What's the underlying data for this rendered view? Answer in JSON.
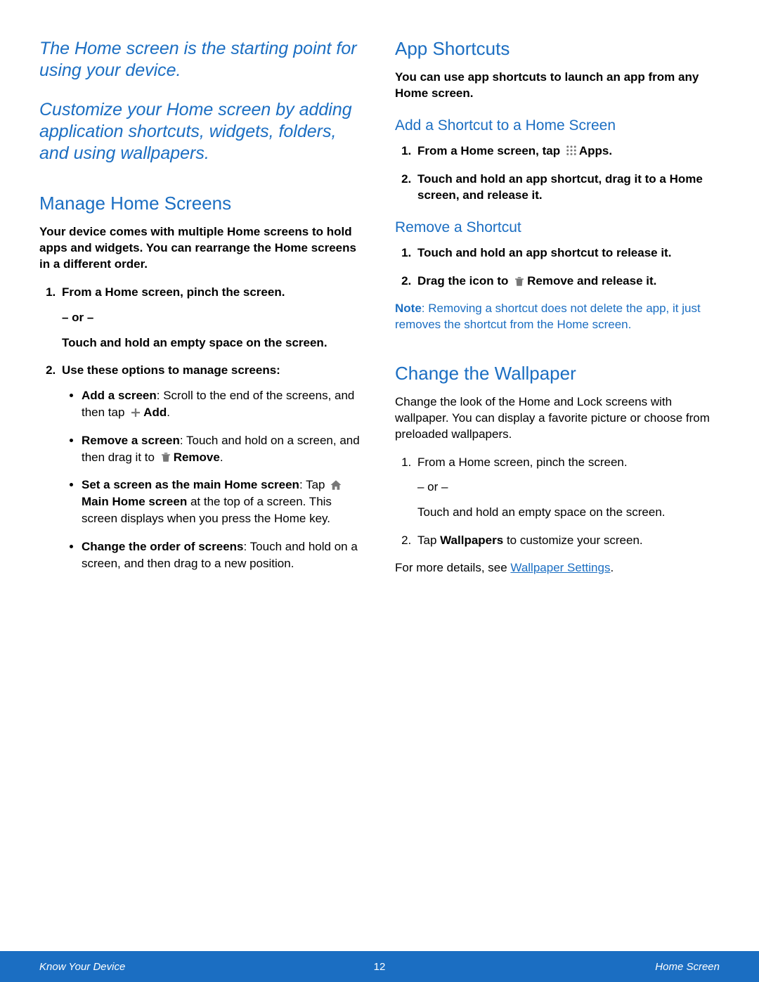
{
  "intro": {
    "p1": "The Home screen is the starting point for using your device.",
    "p2": "Customize your Home screen by adding application shortcuts, widgets, folders, and using wallpapers."
  },
  "manage": {
    "title": "Manage Home Screens",
    "desc": "Your device comes with multiple Home screens to hold apps and widgets. You can rearrange the Home screens in a different order.",
    "s1a": "From a Home screen, pinch the screen.",
    "or": "– or –",
    "s1b": "Touch and hold an empty space on the screen.",
    "s2": "Use these options to manage screens:",
    "b1a": "Add a screen",
    "b1b": ": Scroll to the end of the screens, and then tap ",
    "b1c": "Add",
    "b1d": ".",
    "b2a": "Remove a screen",
    "b2b": ": Touch and hold on a screen, and then drag it to ",
    "b2c": "Remove",
    "b2d": ".",
    "b3a": "Set a screen as the main Home screen",
    "b3b": ": Tap ",
    "b3c": "Main Home screen",
    "b3d": " at the top of a screen. This screen displays when you press the Home key.",
    "b4a": "Change the order of screens",
    "b4b": ": Touch and hold on a screen, and then drag to a new position."
  },
  "shortcuts": {
    "title": "App Shortcuts",
    "desc": "You can use app shortcuts to launch an app from any Home screen.",
    "add_title": "Add a Shortcut to a Home Screen",
    "a1a": "From a Home screen, tap ",
    "a1b": "Apps",
    "a1c": ".",
    "a2": "Touch and hold an app shortcut, drag it to a Home screen, and release it.",
    "rem_title": "Remove a Shortcut",
    "r1": "Touch and hold an app shortcut to release it.",
    "r2a": "Drag the icon to ",
    "r2b": "Remove",
    "r2c": " and release it.",
    "note_label": "Note",
    "note_body": ": Removing a shortcut does not delete the app, it just removes the shortcut from the Home screen."
  },
  "wallpaper": {
    "title": "Change the Wallpaper",
    "desc": "Change the look of the Home and Lock screens with wallpaper. You can display a favorite picture or choose from preloaded wallpapers.",
    "s1a": "From a Home screen, pinch the screen.",
    "or": "– or –",
    "s1b": "Touch and hold an empty space on the screen.",
    "s2a": "Tap ",
    "s2b": "Wallpapers",
    "s2c": " to customize your screen.",
    "more_a": "For more details, see ",
    "more_link": "Wallpaper Settings",
    "more_b": "."
  },
  "footer": {
    "left": "Know Your Device",
    "page": "12",
    "right": "Home Screen"
  }
}
